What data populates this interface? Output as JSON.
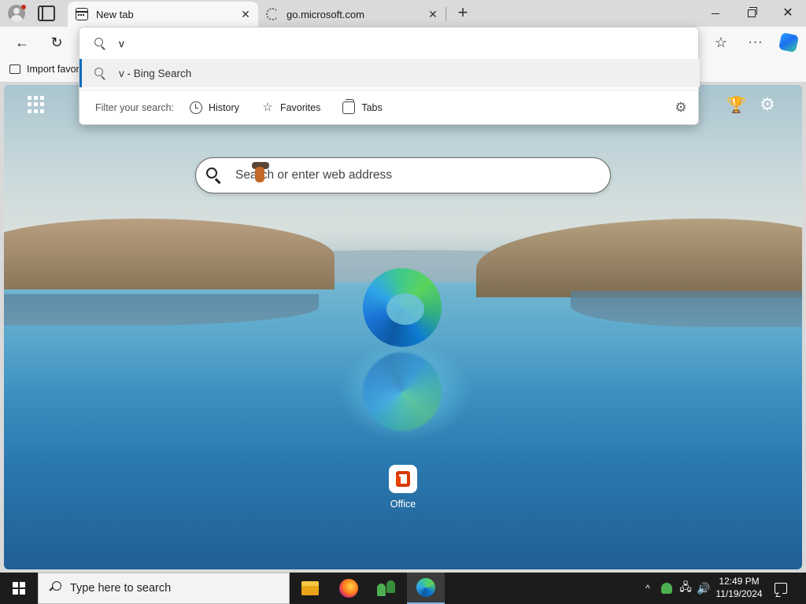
{
  "browser": {
    "tabs": [
      {
        "title": "New tab",
        "active": true,
        "icon": "new-tab-icon"
      },
      {
        "title": "go.microsoft.com",
        "active": false,
        "icon": "loading-spinner-icon"
      }
    ],
    "tab_close_glyph": "✕",
    "new_tab_glyph": "+",
    "window_close_glyph": "✕",
    "nav": {
      "back_glyph": "←",
      "reload_glyph": "↻",
      "favorites_glyph": "☆",
      "more_glyph": "···"
    },
    "favorites_bar": {
      "import_label": "Import favor"
    }
  },
  "omnibox": {
    "query": "v",
    "suggestions": [
      {
        "text": "v - Bing Search",
        "icon": "search-icon",
        "highlighted": true
      }
    ],
    "filter_label": "Filter your search:",
    "filters": [
      {
        "label": "History",
        "icon": "history-icon"
      },
      {
        "label": "Favorites",
        "icon": "star-icon"
      },
      {
        "label": "Tabs",
        "icon": "tabs-icon"
      }
    ],
    "settings_glyph": "⚙"
  },
  "new_tab_page": {
    "search_placeholder": "Search or enter web address",
    "rewards_glyph": "🏆",
    "settings_glyph": "⚙",
    "quick_links": [
      {
        "label": "Office",
        "icon": "office-icon"
      }
    ]
  },
  "taskbar": {
    "search_placeholder": "Type here to search",
    "apps": [
      {
        "name": "File Explorer",
        "icon": "file-explorer-icon",
        "active": false
      },
      {
        "name": "Firefox",
        "icon": "firefox-icon",
        "active": false
      },
      {
        "name": "People",
        "icon": "people-app-icon",
        "active": false
      },
      {
        "name": "Microsoft Edge",
        "icon": "edge-icon",
        "active": true
      }
    ],
    "tray": {
      "chevron_glyph": "^",
      "network_glyph": "🖧",
      "volume_glyph": "🔊",
      "time": "12:49 PM",
      "date": "11/19/2024"
    }
  },
  "colors": {
    "accent": "#0f6cbd",
    "taskbar_bg": "#1c1c1c",
    "tabstrip_bg": "#dadada",
    "toolbar_bg": "#f7f7f7"
  }
}
